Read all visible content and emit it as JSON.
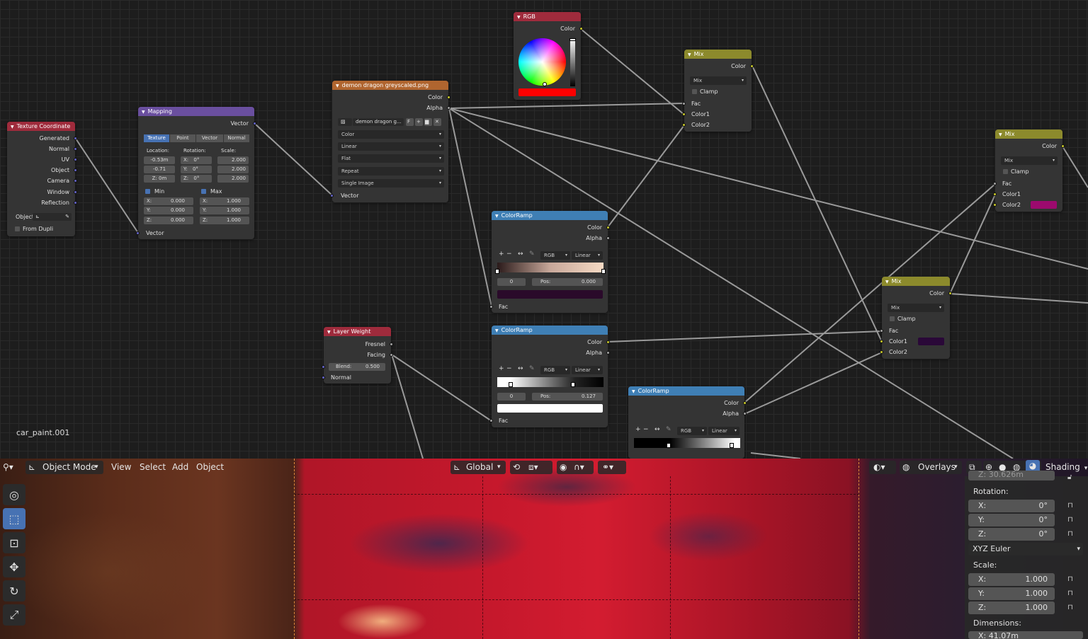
{
  "material_name": "car_paint.001",
  "nodes": {
    "texcoord": {
      "title": "Texture Coordinate",
      "outputs": [
        "Generated",
        "Normal",
        "UV",
        "Object",
        "Camera",
        "Window",
        "Reflection"
      ],
      "object_label": "Object",
      "from_dupli": "From Dupli"
    },
    "mapping": {
      "title": "Mapping",
      "output": "Vector",
      "tabs": [
        "Texture",
        "Point",
        "Vector",
        "Normal"
      ],
      "col_labels": [
        "Location:",
        "Rotation:",
        "Scale:"
      ],
      "loc": [
        "-0.53m",
        "-0.71",
        "Z:  0m"
      ],
      "rot": [
        "X:",
        "0°",
        "Y:",
        "0°",
        "Z:",
        "0°"
      ],
      "scale": [
        "2.000",
        "2.000",
        "2.000"
      ],
      "min_label": "Min",
      "max_label": "Max",
      "min_vals": [
        "0.000",
        "0.000",
        "0.000"
      ],
      "max_vals": [
        "1.000",
        "1.000",
        "1.000"
      ],
      "axes": [
        "X:",
        "Y:",
        "Z:"
      ],
      "input": "Vector"
    },
    "image": {
      "title": "demon dragon greyscaled.png",
      "outputs": [
        "Color",
        "Alpha"
      ],
      "file": "demon dragon g...",
      "file_btn": "F",
      "dropdowns": [
        "Color",
        "Linear",
        "Flat",
        "Repeat",
        "Single Image"
      ],
      "input": "Vector"
    },
    "rgb": {
      "title": "RGB",
      "output": "Color",
      "color": "#ff0000"
    },
    "mix1": {
      "title": "Mix",
      "output": "Color",
      "blend": "Mix",
      "clamp": "Clamp",
      "inputs": [
        "Fac",
        "Color1",
        "Color2"
      ]
    },
    "mix2": {
      "title": "Mix",
      "output": "Color",
      "blend": "Mix",
      "clamp": "Clamp",
      "inputs": [
        "Fac",
        "Color1",
        "Color2"
      ],
      "color2": "#9c0a6e"
    },
    "mix3": {
      "title": "Mix",
      "output": "Color",
      "blend": "Mix",
      "clamp": "Clamp",
      "inputs": [
        "Fac",
        "Color1",
        "Color2"
      ],
      "color1": "#2a0838"
    },
    "ramp1": {
      "title": "ColorRamp",
      "outputs": [
        "Color",
        "Alpha"
      ],
      "mode": "RGB",
      "interp": "Linear",
      "index": "0",
      "pos_label": "Pos:",
      "pos": "0.000",
      "stop_color": "#2a0a2a",
      "input": "Fac"
    },
    "ramp2": {
      "title": "ColorRamp",
      "outputs": [
        "Color",
        "Alpha"
      ],
      "mode": "RGB",
      "interp": "Linear",
      "index": "0",
      "pos_label": "Pos:",
      "pos": "0.127",
      "stop_color": "#ffffff",
      "input": "Fac"
    },
    "ramp3": {
      "title": "ColorRamp",
      "outputs": [
        "Color",
        "Alpha"
      ],
      "mode": "RGB",
      "interp": "Linear"
    },
    "layerweight": {
      "title": "Layer Weight",
      "outputs": [
        "Fresnel",
        "Facing"
      ],
      "blend_label": "Blend:",
      "blend": "0.500",
      "input": "Normal"
    }
  },
  "header": {
    "mode": "Object Mode",
    "menus": [
      "View",
      "Select",
      "Add",
      "Object"
    ],
    "orientation": "Global",
    "overlays": "Overlays",
    "shading": "Shading"
  },
  "npanel": {
    "top_partial": "Z:   30.626m",
    "rotation_label": "Rotation:",
    "rotation": [
      [
        "X:",
        "0°"
      ],
      [
        "Y:",
        "0°"
      ],
      [
        "Z:",
        "0°"
      ]
    ],
    "rotation_mode": "XYZ Euler",
    "scale_label": "Scale:",
    "scale": [
      [
        "X:",
        "1.000"
      ],
      [
        "Y:",
        "1.000"
      ],
      [
        "Z:",
        "1.000"
      ]
    ],
    "dimensions_label": "Dimensions:",
    "dim_partial": "X:   41.07m"
  }
}
